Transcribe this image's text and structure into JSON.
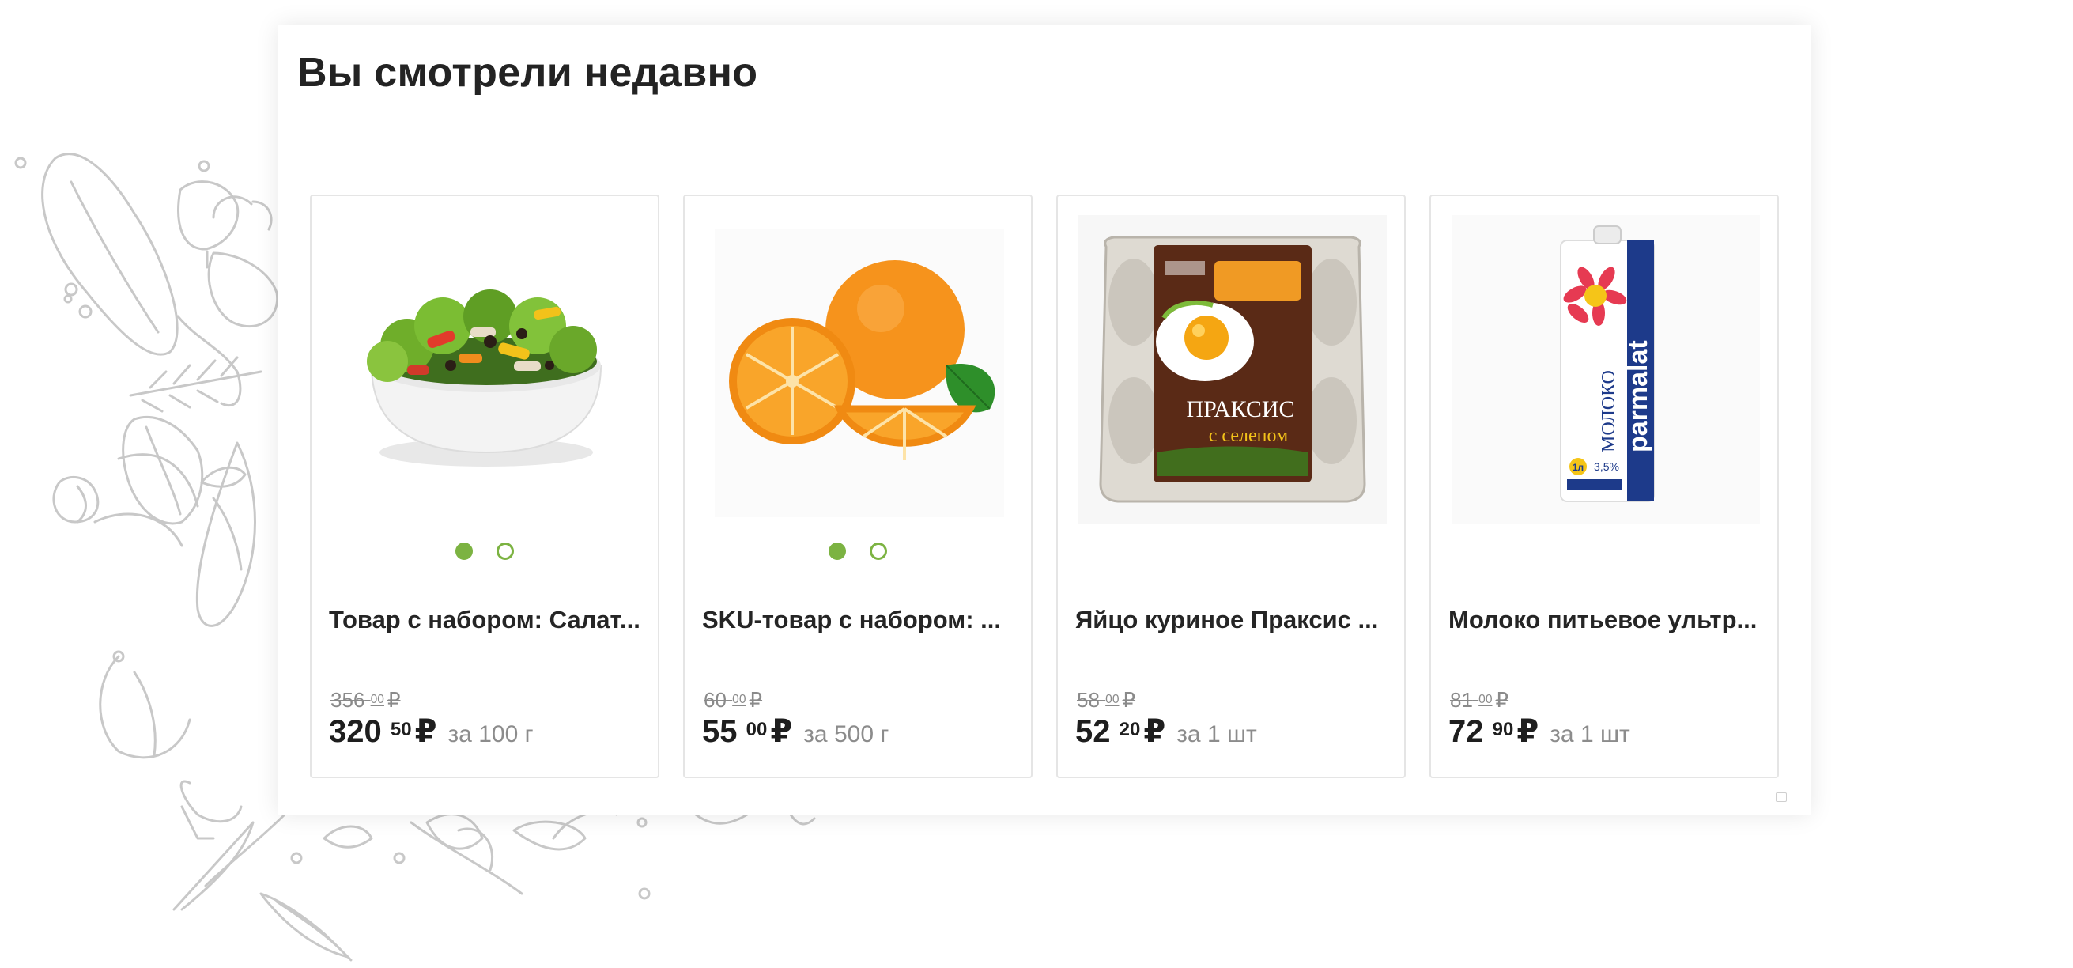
{
  "section_title": "Вы смотрели недавно",
  "currency": "₽",
  "accent_color": "#7cb342",
  "products": [
    {
      "name": "Товар с набором: Салат...",
      "image": "salad-bowl",
      "has_carousel_dots": true,
      "old_price": {
        "whole": "356",
        "cents": "00"
      },
      "price": {
        "whole": "320",
        "cents": "50"
      },
      "unit": "за 100 г"
    },
    {
      "name": "SKU-товар с набором: ...",
      "image": "orange",
      "has_carousel_dots": true,
      "old_price": {
        "whole": "60",
        "cents": "00"
      },
      "price": {
        "whole": "55",
        "cents": "00"
      },
      "unit": "за 500 г"
    },
    {
      "name": "Яйцо куриное Праксис ...",
      "image": "egg-pack",
      "has_carousel_dots": false,
      "old_price": {
        "whole": "58",
        "cents": "00"
      },
      "price": {
        "whole": "52",
        "cents": "20"
      },
      "unit": "за 1 шт",
      "packaging_text": {
        "brand": "ПРАКСИС",
        "tagline": "с селеном"
      }
    },
    {
      "name": "Молоко питьевое ультр...",
      "image": "milk-carton",
      "has_carousel_dots": false,
      "old_price": {
        "whole": "81",
        "cents": "00"
      },
      "price": {
        "whole": "72",
        "cents": "90"
      },
      "unit": "за 1 шт",
      "packaging_text": {
        "brand": "parmalat",
        "product": "МОЛОКО",
        "volume": "1л",
        "fat": "3,5%"
      }
    }
  ]
}
